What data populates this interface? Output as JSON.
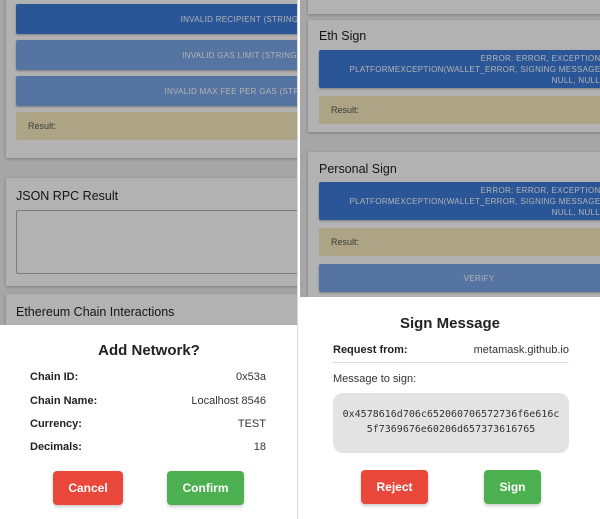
{
  "colors": {
    "blue": "#3d7bd9",
    "blue_light": "#7aa6e8",
    "result_bg": "#f6ebbd",
    "red": "#e8473a",
    "green": "#4caf50"
  },
  "left": {
    "buttons": [
      "INVALID RECIPIENT (STRING)",
      "INVALID GAS LIMIT (STRING)",
      "INVALID MAX FEE PER GAS (STRING)"
    ],
    "result_label": "Result:",
    "json_rpc_title": "JSON RPC Result",
    "chain_interactions_title": "Ethereum Chain Interactions",
    "dialog": {
      "title": "Add Network?",
      "rows": [
        {
          "label": "Chain ID:",
          "value": "0x53a"
        },
        {
          "label": "Chain Name:",
          "value": "Localhost 8546"
        },
        {
          "label": "Currency:",
          "value": "TEST"
        },
        {
          "label": "Decimals:",
          "value": "18"
        }
      ],
      "cancel": "Cancel",
      "confirm": "Confirm"
    }
  },
  "right": {
    "eth_sign_title": "Eth Sign",
    "eth_sign_error": "ERROR: ERROR, EXCEPTION: PLATFORMEXCEPTION(WALLET_ERROR, SIGNING MESSAGE, NULL, NULL)",
    "result_label": "Result:",
    "personal_sign_title": "Personal Sign",
    "personal_sign_error": "ERROR: ERROR, EXCEPTION: PLATFORMEXCEPTION(WALLET_ERROR, SIGNING MESSAGE, NULL, NULL)",
    "result_label_2": "Result:",
    "verify": "VERIFY",
    "dialog": {
      "title": "Sign Message",
      "request_from_label": "Request from:",
      "request_from_value": "metamask.github.io",
      "message_label": "Message to sign:",
      "message": "0x4578616d706c652060706572736f6e616c5f7369676e60206d657373616765",
      "reject": "Reject",
      "sign": "Sign"
    }
  }
}
